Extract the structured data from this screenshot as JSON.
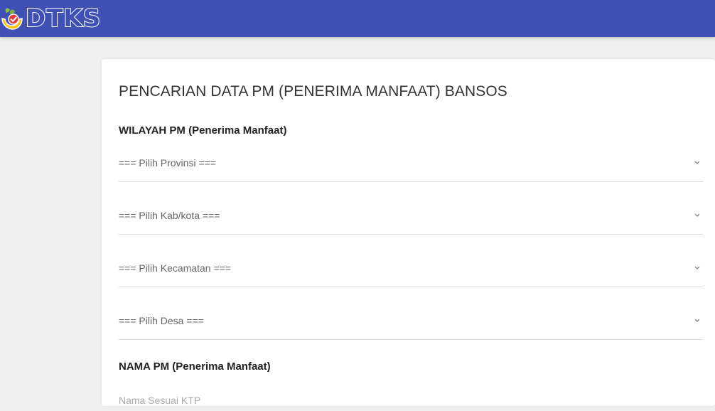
{
  "header": {
    "logo_text": "DTKS",
    "logo_icon": "dtks-hands-check-logo-icon",
    "background_color": "#3f51b5"
  },
  "form": {
    "title": "PENCARIAN DATA PM (PENERIMA MANFAAT) BANSOS",
    "wilayah_label": "WILAYAH PM (Penerima Manfaat)",
    "selects": [
      {
        "placeholder": "=== Pilih Provinsi ===",
        "icon": "chevron-down-icon"
      },
      {
        "placeholder": "=== Pilih Kab/kota ===",
        "icon": "chevron-down-icon"
      },
      {
        "placeholder": "=== Pilih Kecamatan ===",
        "icon": "chevron-down-icon"
      },
      {
        "placeholder": "=== Pilih Desa ===",
        "icon": "chevron-down-icon"
      }
    ],
    "nama_label": "NAMA PM (Penerima Manfaat)",
    "nama_input": {
      "value": "",
      "placeholder": "Nama Sesuai KTP"
    }
  }
}
